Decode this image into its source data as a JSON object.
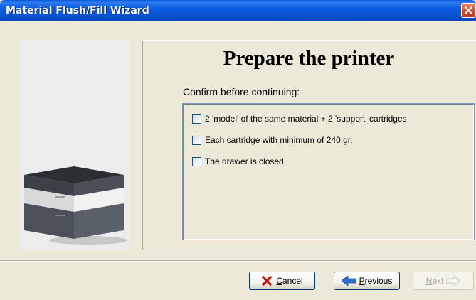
{
  "window": {
    "title": "Material Flush/Fill Wizard"
  },
  "page": {
    "heading": "Prepare the printer",
    "confirm_label": "Confirm before continuing:",
    "checklist": [
      {
        "label": "2 'model' of the same material + 2 'support' cartridges",
        "checked": false
      },
      {
        "label": "Each cartridge with minimum of 240 gr.",
        "checked": false
      },
      {
        "label": "The drawer is closed.",
        "checked": false
      }
    ]
  },
  "buttons": {
    "cancel": {
      "first": "C",
      "rest": "ancel",
      "enabled": true
    },
    "previous": {
      "first": "P",
      "rest": "revious",
      "enabled": true
    },
    "next": {
      "first": "N",
      "rest": "ext",
      "enabled": false
    }
  },
  "colors": {
    "titlebar": "#0a5bd6",
    "dialog_bg": "#ece9d8",
    "close_red": "#d54a2a"
  }
}
